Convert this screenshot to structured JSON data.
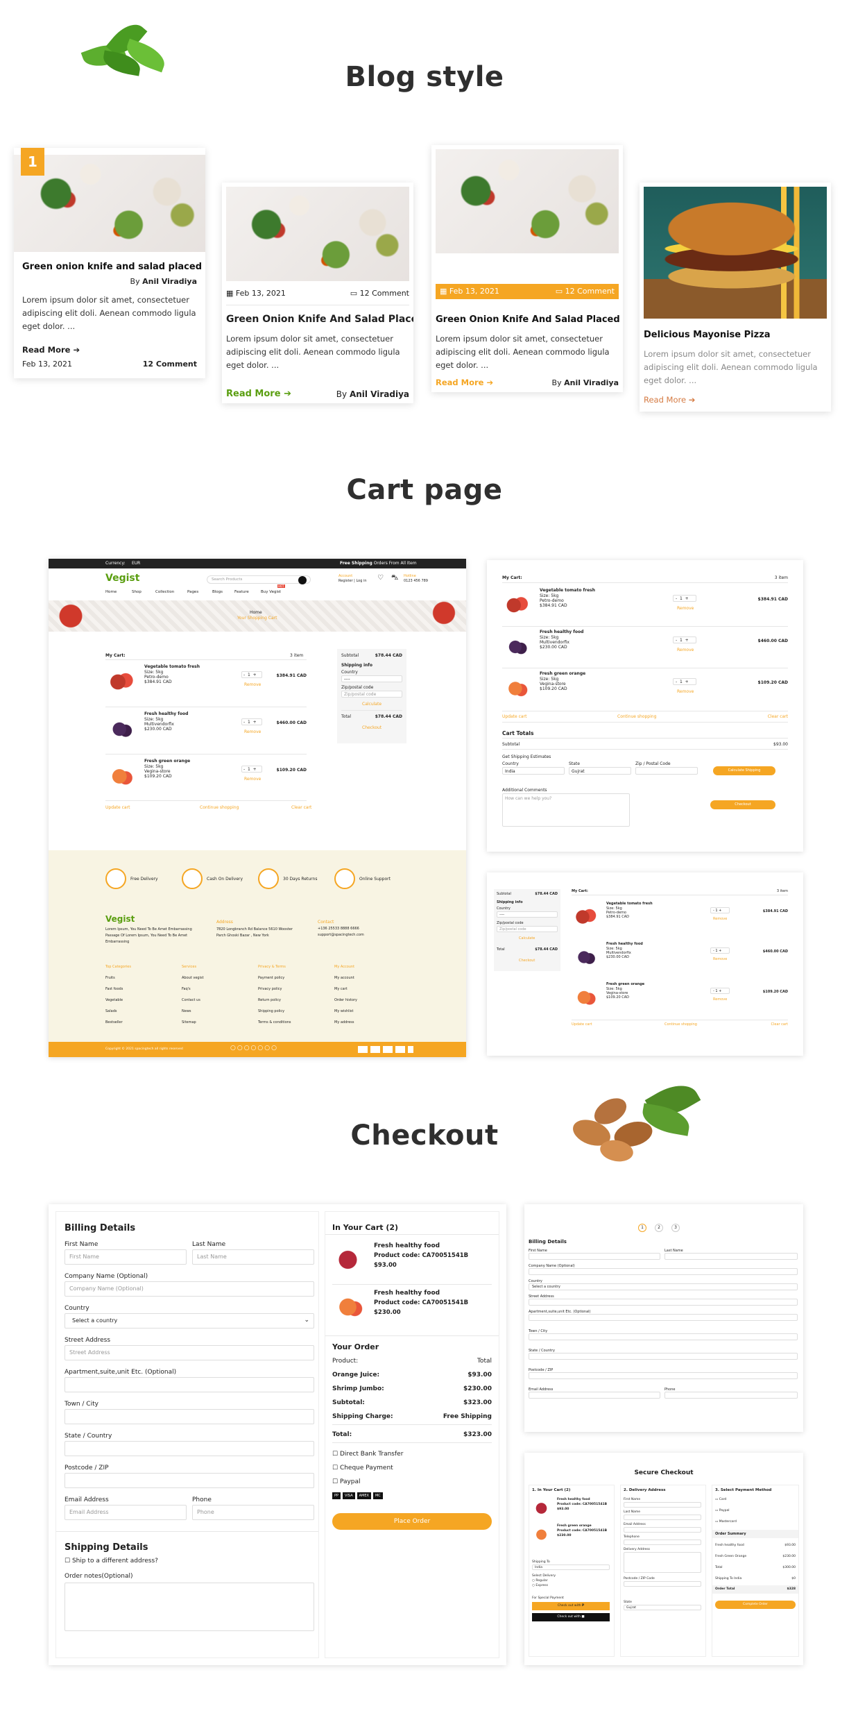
{
  "sections": {
    "blog_title": "Blog style",
    "cart_title": "Cart page",
    "checkout_title": "Checkout"
  },
  "blog": {
    "card1": {
      "badge": "1",
      "title": "Green onion knife and salad placed",
      "author_prefix": "By",
      "author": "Anil Viradiya",
      "text": "Lorem ipsum dolor sit amet, consectetuer adipiscing elit doli. Aenean commodo ligula eget dolor. ...",
      "read_more": "Read More",
      "date": "Feb 13, 2021",
      "comments": "12 Comment"
    },
    "card2": {
      "date": "Feb 13, 2021",
      "comments": "12 Comment",
      "title": "Green Onion Knife And Salad Placed",
      "text": "Lorem ipsum dolor sit amet, consectetuer adipiscing elit doli. Aenean commodo ligula eget dolor. ...",
      "read_more": "Read More",
      "author_prefix": "By",
      "author": "Anil Viradiya"
    },
    "card3": {
      "date": "Feb 13, 2021",
      "comments": "12 Comment",
      "title": "Green Onion Knife And Salad Placed",
      "text": "Lorem ipsum dolor sit amet, consectetuer adipiscing elit doli. Aenean commodo ligula eget dolor. ...",
      "read_more": "Read More",
      "author_prefix": "By",
      "author": "Anil Viradiya"
    },
    "card4": {
      "title": "Delicious Mayonise Pizza",
      "text": "Lorem ipsum dolor sit amet, consectetuer adipiscing elit doli. Aenean commodo ligula eget dolor. ...",
      "read_more": "Read More"
    }
  },
  "cart_main": {
    "topbar_currency": "Currency:",
    "topbar_currency_val": "EUR",
    "topbar_promo_bold": "Free Shipping",
    "topbar_promo": "Orders From All Item",
    "logo": "Vegist",
    "search_placeholder": "Search Products",
    "account": "Account",
    "register": "Register | Log in",
    "wishlist_count": "0",
    "cart_count": "0",
    "hotline_label": "Hotline",
    "hotline": "0123 456 789",
    "nav": [
      "Home",
      "Shop",
      "Collection",
      "Pages",
      "Blogs",
      "Feature",
      "Buy Vegist"
    ],
    "nav_badge": "HOT",
    "breadcrumb_home": "Home",
    "breadcrumb_current": "Your Shopping Cart",
    "my_cart": "My Cart:",
    "item_count": "3 item",
    "items": [
      {
        "name": "Vegetable tomato fresh",
        "size": "Size: 5kg",
        "vendor": "Petro-demo",
        "price": "$384.91 CAD",
        "qty": "1",
        "remove": "Remove",
        "total": "$384.91 CAD"
      },
      {
        "name": "Fresh healthy food",
        "size": "Size: 5kg",
        "vendor": "Multivendorfix",
        "price": "$230.00 CAD",
        "qty": "1",
        "remove": "Remove",
        "total": "$460.00 CAD"
      },
      {
        "name": "Fresh green orange",
        "size": "Size: 5kg",
        "vendor": "Vegina-store",
        "price": "$109.20 CAD",
        "qty": "1",
        "remove": "Remove",
        "total": "$109.20 CAD"
      }
    ],
    "update_cart": "Update cart",
    "continue_shopping": "Continue shopping",
    "clear_cart": "Clear cart",
    "subtotal_label": "Subtotal",
    "subtotal": "$78.44 CAD",
    "shipping_info": "Shipping info",
    "country_label": "Country",
    "country_val": "----",
    "zip_label": "Zip/postal code",
    "zip_placeholder": "Zip/postal code",
    "calculate": "Calculate",
    "total_label": "Total",
    "total": "$78.44 CAD",
    "checkout": "Checkout",
    "features": [
      "Free Delivery",
      "Cash On Delivery",
      "30 Days Returns",
      "Online Support"
    ],
    "footer_about": "Lorem Ipsum, You Need To Be Amet Embarrassing Passage Of Lorem Ipsum, You Need To Be Amet Embarrassing",
    "address_title": "Address",
    "address": "7820 Longbranch Rd Balance 5610 Wooster Parch Ghoski Bazar , New York",
    "contact_title": "Contact",
    "phone": "+136 25533 8888 6666",
    "email": "support@spacingtech.com",
    "cols": [
      {
        "title": "Top Categories",
        "items": [
          "Fruits",
          "Fast foods",
          "Vegetable",
          "Salads",
          "Bestseller"
        ]
      },
      {
        "title": "Services",
        "items": [
          "About vegist",
          "Faq's",
          "Contact us",
          "News",
          "Sitemap"
        ]
      },
      {
        "title": "Privacy & Terms",
        "items": [
          "Payment policy",
          "Privacy policy",
          "Return policy",
          "Shipping policy",
          "Terms & conditions"
        ]
      },
      {
        "title": "My Account",
        "items": [
          "My account",
          "My cart",
          "Order history",
          "My wishlist",
          "My address"
        ]
      }
    ],
    "copyright": "Copyright © 2021 spacingtech all rights reserved"
  },
  "cart_right1": {
    "my_cart": "My Cart:",
    "item_count": "3 item",
    "items": [
      {
        "name": "Vegetable tomato fresh",
        "size": "Size: 5kg",
        "vendor": "Petro-demo",
        "price": "$384.91 CAD",
        "remove": "Remove",
        "total": "$384.91 CAD"
      },
      {
        "name": "Fresh healthy food",
        "size": "Size: 5kg",
        "vendor": "Multivendorfix",
        "price": "$230.00 CAD",
        "remove": "Remove",
        "total": "$460.00 CAD"
      },
      {
        "name": "Fresh green orange",
        "size": "Size: 5kg",
        "vendor": "Vegina-store",
        "price": "$109.20 CAD",
        "remove": "Remove",
        "total": "$109.20 CAD"
      }
    ],
    "update_cart": "Update cart",
    "continue_shopping": "Continue shopping",
    "clear_cart": "Clear cart",
    "cart_totals": "Cart Totals",
    "subtotal_label": "Subtotal",
    "subtotal": "$93.00",
    "get_shipping": "Get Shipping Estimates",
    "country_label": "Country",
    "state_label": "State",
    "zip_label": "Zip / Postal Code",
    "country_val": "India",
    "state_val": "Gujrat",
    "calc_btn": "Calculate Shipping",
    "instructions": "Additional Comments",
    "instructions_ph": "How can we help you?",
    "checkout": "Checkout"
  },
  "checkout_main": {
    "billing_title": "Billing Details",
    "first_name": "First Name",
    "last_name": "Last Name",
    "company": "Company Name (Optional)",
    "country": "Country",
    "country_select": "Select a country",
    "street": "Street Address",
    "apartment": "Apartment,suite,unit Etc. (Optional)",
    "town": "Town / City",
    "state": "State / Country",
    "postcode": "Postcode / ZIP",
    "email": "Email Address",
    "phone": "Phone",
    "shipping_title": "Shipping Details",
    "ship_diff": "Ship to a different address?",
    "order_notes": "Order notes(Optional)",
    "in_cart": "In Your Cart (2)",
    "cart_items": [
      {
        "name": "Fresh healthy food",
        "code": "Product code: CA70051541B",
        "price": "$93.00"
      },
      {
        "name": "Fresh healthy food",
        "code": "Product code: CA70051541B",
        "price": "$230.00"
      }
    ],
    "your_order": "Your Order",
    "rows": [
      {
        "label": "Product:",
        "value": "Total"
      },
      {
        "label": "Orange Juice:",
        "value": "$93.00"
      },
      {
        "label": "Shrimp Jumbo:",
        "value": "$230.00"
      },
      {
        "label": "Subtotal:",
        "value": "$323.00"
      },
      {
        "label": "Shipping Charge:",
        "value": "Free Shipping"
      },
      {
        "label": "Total:",
        "value": "$323.00"
      }
    ],
    "payments": [
      "Direct Bank Transfer",
      "Cheque Payment",
      "Paypal"
    ],
    "cards": [
      "PP",
      "VISA",
      "AMEX",
      "MC"
    ],
    "place_order": "Place Order"
  },
  "checkout_right2": {
    "title": "Secure Checkout",
    "col1": "1. In Your Cart (2)",
    "col2": "2. Delivery Address",
    "col3": "3. Select Payment Method",
    "items": [
      {
        "name": "Fresh healthy food",
        "code": "Product code: CA70051541B",
        "price": "$93.00"
      },
      {
        "name": "Fresh green orange",
        "code": "Product code: CA70051541B",
        "price": "$230.00"
      }
    ],
    "pay_methods": [
      "Card",
      "Paypal",
      "Mastercard"
    ],
    "summary_title": "Order Summary",
    "summary": [
      {
        "label": "Fresh healthy food",
        "value": "$93.00"
      },
      {
        "label": "Fresh Green Orange",
        "value": "$230.00"
      },
      {
        "label": "Total",
        "value": "$300.00"
      },
      {
        "label": "Shipping To India",
        "value": "$0"
      },
      {
        "label": "Order Total",
        "value": "$328"
      }
    ],
    "complete": "Complete Order",
    "checkout_with_paypal": "Check out with",
    "delivery_fields": [
      "First Name",
      "Last Name",
      "Email Address",
      "Telephone",
      "Delivery Address",
      "Postcode / ZIP Code",
      "State"
    ],
    "state_val": "Gujrat",
    "ship_to": "Shipping To",
    "ship_to_val": "India",
    "select_delivery": "Select Delivery",
    "delivery_opts": [
      "Regular",
      "Express"
    ],
    "for_special": "For Special Payment"
  },
  "checkout_right1": {
    "steps": [
      "1",
      "2",
      "3"
    ],
    "billing_title": "Billing Details"
  },
  "colors": {
    "accent": "#f5a623",
    "green": "#5a9e10",
    "footer_bg": "#f8f4e3"
  }
}
